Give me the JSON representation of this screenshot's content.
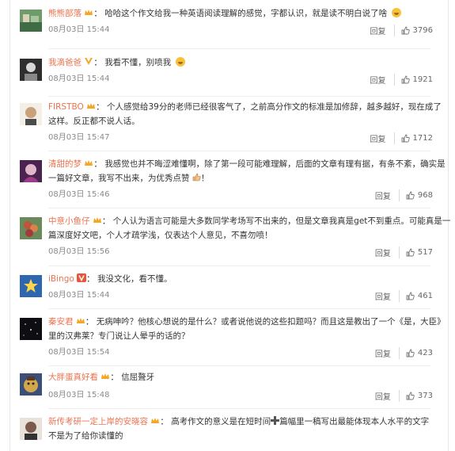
{
  "comments": [
    {
      "user": "熊熊部落",
      "text": "哈哈这个作文给我一种英语阅读理解的感觉，字都认识，就是读不明白说了啥",
      "line2": "",
      "time": "08月03日 15:44",
      "reply": "回复",
      "likes": "3796",
      "emoji": true,
      "avatar_color": "#5b8d5a"
    },
    {
      "user": "我滴爸爸",
      "text": "我看不懂，别喷我",
      "line2": "",
      "time": "08月03日 15:44",
      "reply": "回复",
      "likes": "1921",
      "emoji": true,
      "avatar_color": "#3b3b3b"
    },
    {
      "user": "FIRSTBO",
      "text": "个人感觉给39分的老师已经很客气了，之前高分作文的标准是加修辞，越多越好，现在成了",
      "line2": "这样。反正都不说人话。",
      "time": "08月03日 15:47",
      "reply": "回复",
      "likes": "1712",
      "emoji": false,
      "avatar_color": "#c9a27a"
    },
    {
      "user": "清甜的梦",
      "text": "我感觉也并不晦涩难懂啊，除了第一段可能难理解，后面的文章有理有据，有条不紊，确实是",
      "line2": "一篇好文章，我写不出来，为优秀点赞",
      "line2_suffix": "！",
      "time": "08月03日 15:46",
      "reply": "回复",
      "likes": "968",
      "emoji": false,
      "avatar_color": "#8a3a7a"
    },
    {
      "user": "中意小鱼仔",
      "text": "个人认为语言可能是大多数同学考场写不出来的，但是文章我真是get不到重点。可能真是一",
      "line2": "篇深度好文吧，个人才疏学浅，仅表达个人意见，不喜勿喷！",
      "time": "08月03日 15:56",
      "reply": "回复",
      "likes": "517",
      "emoji": false,
      "avatar_color": "#c0533a"
    },
    {
      "user": "iBingo",
      "text": "我没文化，看不懂。",
      "line2": "",
      "time": "08月03日 15:44",
      "reply": "回复",
      "likes": "461",
      "emoji": false,
      "avatar_color": "#3a6fb5"
    },
    {
      "user": "秦安君",
      "text": "无病呻吟？他核心想说的是什么？或者说他说的这些扣题吗？而且这是教出了一个《是，大臣》",
      "line2": "里的汉弗莱？专门说让人晕乎的话的？",
      "time": "08月03日 15:54",
      "reply": "回复",
      "likes": "423",
      "emoji": false,
      "avatar_color": "#111111"
    },
    {
      "user": "大胖蛋真好看",
      "text": "信屈聱牙",
      "line2": "",
      "time": "08月03日 15:48",
      "reply": "回复",
      "likes": "373",
      "emoji": false,
      "avatar_color": "#c9a24a"
    },
    {
      "user": "新传考研一定上岸的安晓容",
      "text": "高考作文的意义是在短时间",
      "text_mid": "篇幅里一稿写出最能体现本人水平的文字",
      "line2": "不是为了给你读懂的",
      "time": "",
      "reply": "",
      "likes": "",
      "emoji": false,
      "avatar_color": "#7a5a4a"
    }
  ],
  "colors": {
    "username": "#eb7350",
    "time": "#8a8a8a",
    "text": "#333333"
  },
  "icons": [
    "crown-badge-icon",
    "vip-v-icon",
    "thumbs-up-icon",
    "smile-emoji-icon"
  ]
}
